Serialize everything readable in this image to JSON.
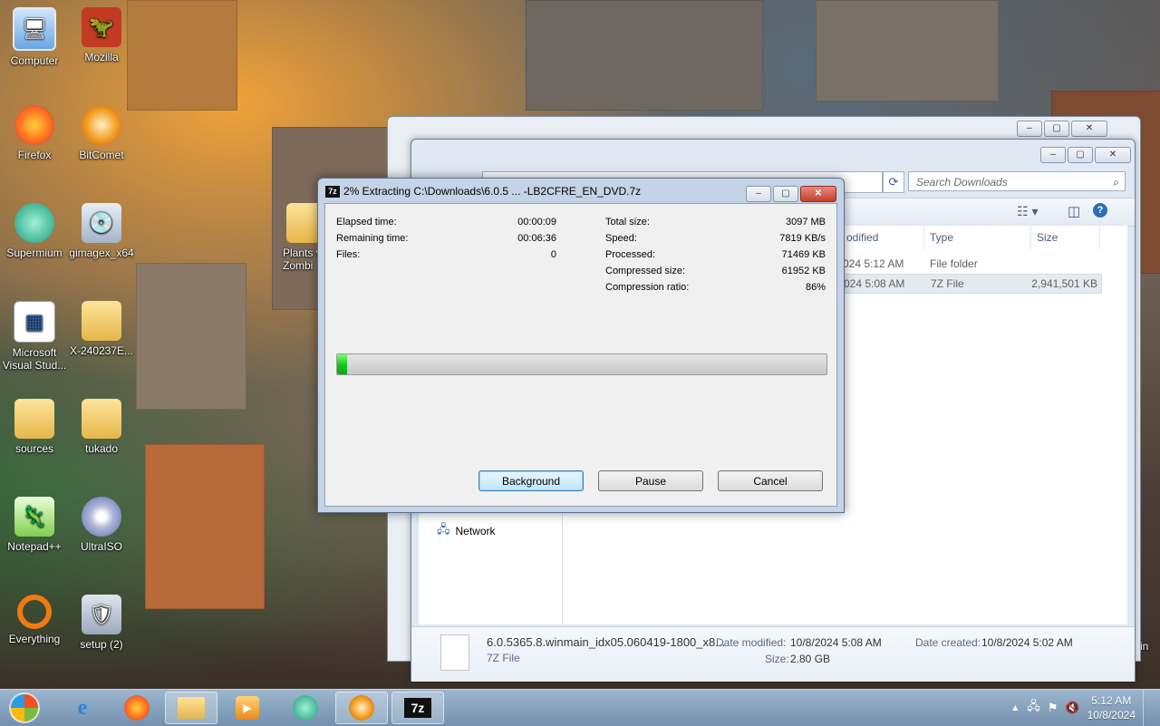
{
  "desktop": {
    "icons": [
      {
        "label": "Computer"
      },
      {
        "label": "Mozilla"
      },
      {
        "label": "Firefox"
      },
      {
        "label": "BitComet"
      },
      {
        "label": "Supermium"
      },
      {
        "label": "gimagex_x64"
      },
      {
        "label": "Plants v Zombi"
      },
      {
        "label": "Microsoft Visual Stud..."
      },
      {
        "label": "X-240237E..."
      },
      {
        "label": "sources"
      },
      {
        "label": "tukado"
      },
      {
        "label": "Notepad++"
      },
      {
        "label": "UltraISO"
      },
      {
        "label": "Everything"
      },
      {
        "label": "setup (2)"
      },
      {
        "label": "Bin"
      }
    ]
  },
  "explorer": {
    "search_placeholder": "Search Downloads",
    "columns": {
      "modified": "odified",
      "type": "Type",
      "size": "Size"
    },
    "rows": [
      {
        "modified": "024 5:12 AM",
        "type": "File folder",
        "size": ""
      },
      {
        "modified": "024 5:08 AM",
        "type": "7Z File",
        "size": "2,941,501 KB"
      }
    ],
    "nav_network": "Network",
    "details": {
      "name": "6.0.5365.8.winmain_idx05.060419-1800_x8...",
      "type": "7Z File",
      "modified_label": "Date modified:",
      "modified_value": "10/8/2024 5:08 AM",
      "size_label": "Size:",
      "size_value": "2.80 GB",
      "created_label": "Date created:",
      "created_value": "10/8/2024 5:02 AM"
    }
  },
  "dialog": {
    "icon_text": "7z",
    "title": "2% Extracting C:\\Downloads\\6.0.5 ... -LB2CFRE_EN_DVD.7z",
    "left_stats": [
      {
        "label": "Elapsed time:",
        "value": "00:00:09"
      },
      {
        "label": "Remaining time:",
        "value": "00:06:36"
      },
      {
        "label": "Files:",
        "value": "0"
      }
    ],
    "right_stats": [
      {
        "label": "Total size:",
        "value": "3097 MB"
      },
      {
        "label": "Speed:",
        "value": "7819 KB/s"
      },
      {
        "label": "Processed:",
        "value": "71469 KB"
      },
      {
        "label": "Compressed size:",
        "value": "61952 KB"
      },
      {
        "label": "Compression ratio:",
        "value": "86%"
      }
    ],
    "progress_percent": 2,
    "buttons": {
      "background": "Background",
      "pause": "Pause",
      "cancel": "Cancel"
    }
  },
  "taskbar": {
    "clock_time": "5:12 AM",
    "clock_date": "10/8/2024",
    "zip_label": "7z"
  }
}
